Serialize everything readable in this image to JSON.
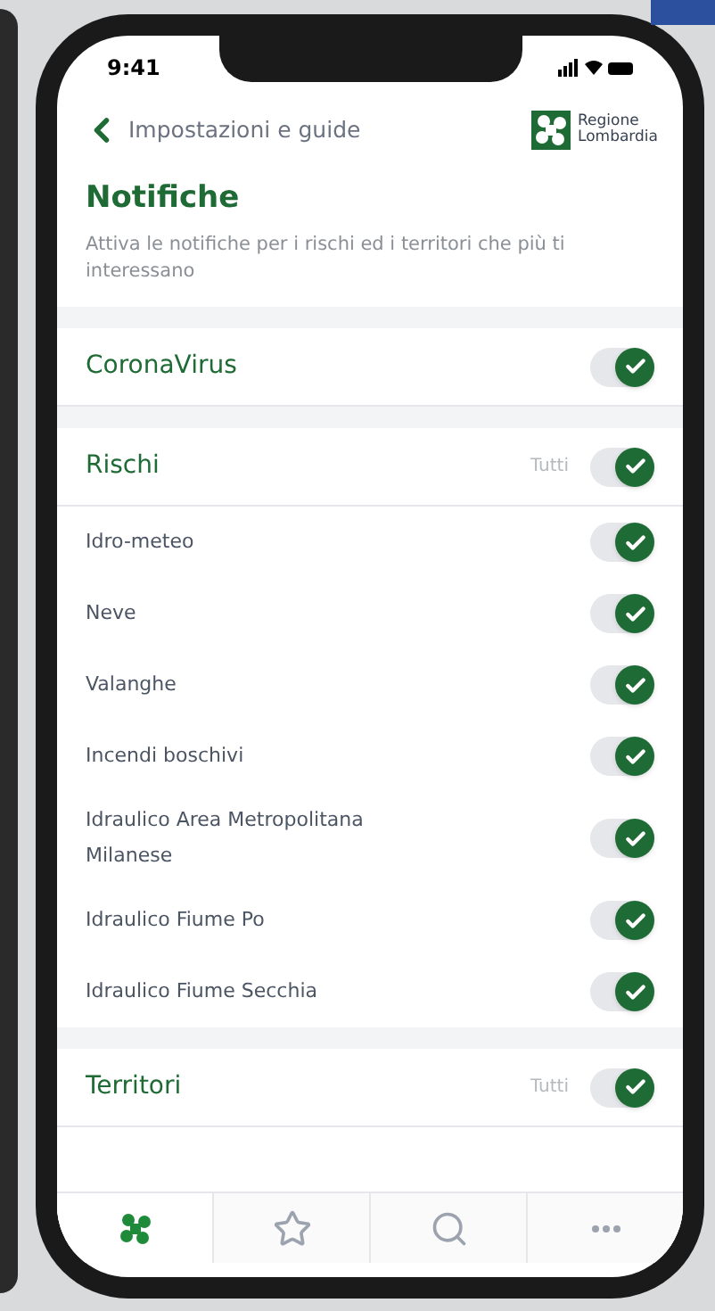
{
  "status_bar": {
    "time": "9:41"
  },
  "nav": {
    "back_label": "Impostazioni e guide",
    "logo_lines": [
      "Regione",
      "Lombardia"
    ]
  },
  "title": "Notifiche",
  "description": "Attiva le notifiche per i rischi ed i territori che più ti interessano",
  "groups": [
    {
      "title": "CoronaVirus",
      "on": true
    },
    {
      "title": "Rischi",
      "all_label": "Tutti",
      "on": true,
      "items": [
        {
          "label": "Idro-meteo",
          "on": true
        },
        {
          "label": "Neve",
          "on": true
        },
        {
          "label": "Valanghe",
          "on": true
        },
        {
          "label": "Incendi boschivi",
          "on": true
        },
        {
          "label": "Idraulico Area Metropolitana Milanese",
          "on": true
        },
        {
          "label": "Idraulico Fiume Po",
          "on": true
        },
        {
          "label": "Idraulico Fiume Secchia",
          "on": true
        }
      ]
    },
    {
      "title": "Territori",
      "all_label": "Tutti",
      "on": true
    }
  ],
  "tab_bar": [
    {
      "kind": "home",
      "selected": true
    },
    {
      "kind": "favorites",
      "selected": false
    },
    {
      "kind": "search",
      "selected": false
    },
    {
      "kind": "more",
      "selected": false
    }
  ]
}
